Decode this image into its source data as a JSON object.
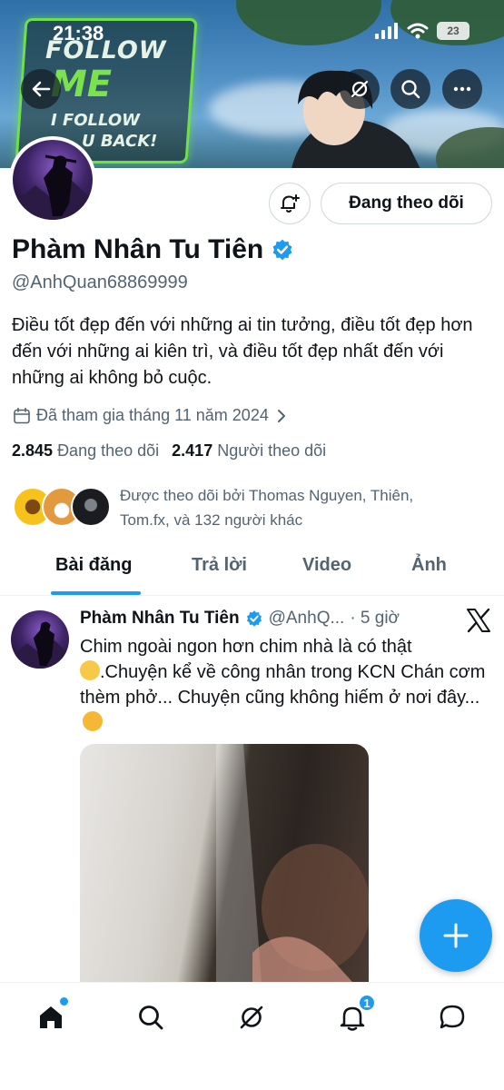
{
  "status_bar": {
    "time": "21:38",
    "battery": "23"
  },
  "profile": {
    "display_name": "Phàm Nhân Tu Tiên",
    "handle": "@AnhQuan68869999",
    "bio": "Điều tốt đẹp đến với những ai tin tưởng, điều tốt đẹp hơn đến với những ai kiên trì, và điều tốt đẹp nhất đến với những ai không bỏ cuộc.",
    "joined": "Đã tham gia tháng 11 năm 2024",
    "following_count": "2.845",
    "following_label": "Đang theo dõi",
    "followers_count": "2.417",
    "followers_label": "Người theo dõi",
    "followed_by": "Được theo dõi bởi Thomas Nguyen, Thiên, Tom.fx, và 132 người khác",
    "follow_button": "Đang theo dõi"
  },
  "banner": {
    "promo_line_1": "FOLLOW",
    "promo_line_2": "ME",
    "promo_line_3": "I FOLLOW",
    "promo_line_4": "U BACK!"
  },
  "tabs": [
    {
      "label": "Bài đăng",
      "active": true
    },
    {
      "label": "Trả lời",
      "active": false
    },
    {
      "label": "Video",
      "active": false
    },
    {
      "label": "Ảnh",
      "active": false
    }
  ],
  "post": {
    "author": "Phàm Nhân Tu Tiên",
    "handle": "@AnhQ...",
    "time": "· 5 giờ",
    "text_1": "Chim ngoài ngon hơn chim nhà là có thật",
    "text_2": ".Chuyện kể về công nhân trong KCN Chán cơm thèm phở... Chuyện cũng không hiếm ở nơi đây..."
  },
  "nav": {
    "notification_badge": "1"
  },
  "colors": {
    "accent": "#1d9bf0",
    "text": "#0f1419",
    "muted": "#536471",
    "border": "#cfd9de"
  },
  "icons": [
    "back-arrow-icon",
    "grok-icon",
    "search-icon",
    "more-icon",
    "bell-plus-icon",
    "verified-icon",
    "calendar-icon",
    "chevron-right-icon",
    "x-logo-icon",
    "compose-plus-icon",
    "home-icon",
    "search-icon",
    "grok-icon",
    "bell-icon",
    "messages-icon"
  ]
}
